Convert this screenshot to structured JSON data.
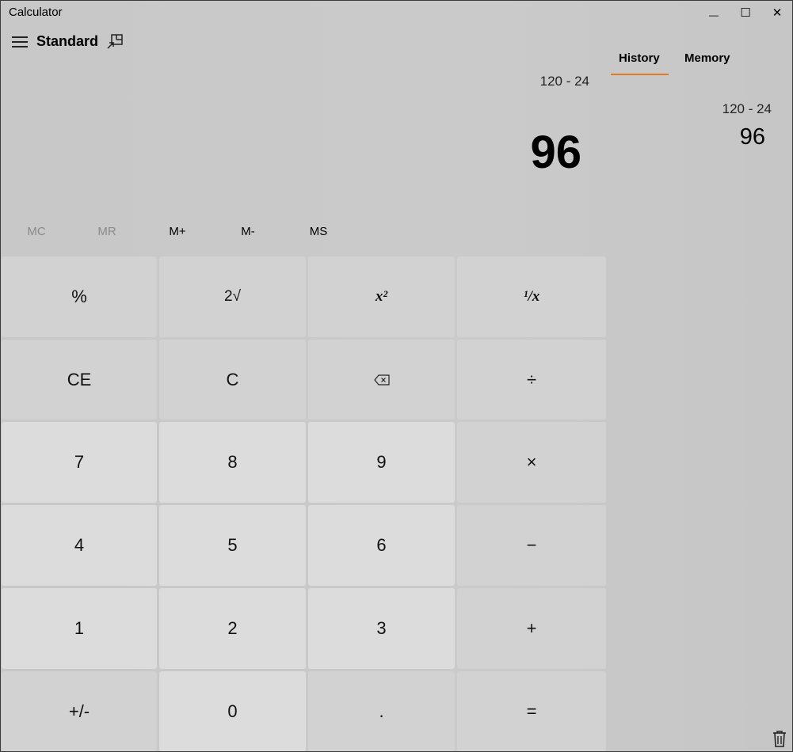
{
  "window": {
    "title": "Calculator",
    "minimize_glyph": "—",
    "maximize_glyph": "☐",
    "close_glyph": "✕"
  },
  "header": {
    "mode": "Standard",
    "menu_icon": "hamburger-icon",
    "keep_on_top_icon": "keep-on-top-icon"
  },
  "display": {
    "expression": "120 - 24",
    "result": "96"
  },
  "memory": {
    "mc": "MC",
    "mr": "MR",
    "mplus": "M+",
    "mminus": "M-",
    "ms": "MS"
  },
  "keys": {
    "percent": "%",
    "sqrt": "2√",
    "square": "x²",
    "reciprocal": "¹/x",
    "ce": "CE",
    "clear": "C",
    "backspace_icon": "backspace-icon",
    "divide": "÷",
    "seven": "7",
    "eight": "8",
    "nine": "9",
    "multiply": "×",
    "four": "4",
    "five": "5",
    "six": "6",
    "minus": "−",
    "one": "1",
    "two": "2",
    "three": "3",
    "plus": "+",
    "negate": "+/-",
    "zero": "0",
    "decimal": ".",
    "equals": "="
  },
  "panel": {
    "tab_history": "History",
    "tab_memory": "Memory",
    "history": [
      {
        "expression": "120 - 24",
        "result": "96"
      }
    ],
    "trash_icon": "trash-icon"
  },
  "colors": {
    "accent": "#e27a20",
    "background": "#cccccc",
    "number_key": "#dcdcdc",
    "function_key": "#d2d2d2"
  }
}
